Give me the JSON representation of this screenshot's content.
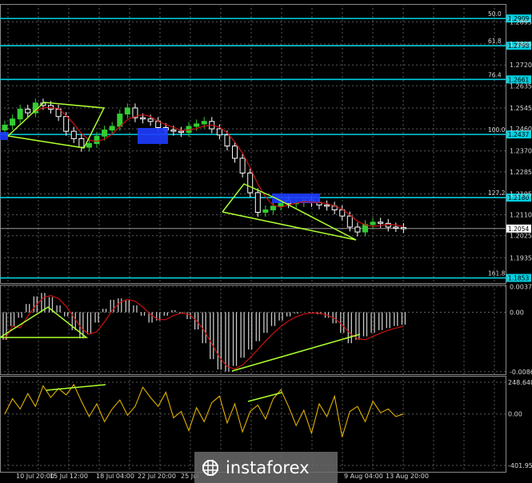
{
  "chart_data": [
    {
      "type": "candlestick",
      "panel": "price",
      "grid": true,
      "ylim": [
        1.1832,
        1.2968
      ],
      "y_ticks": [
        "1.2895",
        "1.2805",
        "1.2720",
        "1.2635",
        "1.2545",
        "1.2460",
        "1.2370",
        "1.2285",
        "1.2195",
        "1.2110",
        "1.2025",
        "1.1935"
      ],
      "current_price": "1.2054",
      "fib_levels": [
        {
          "ratio": "50.0",
          "price": "1.2909",
          "value": 1.2909
        },
        {
          "ratio": "61.8",
          "price": "1.2798",
          "value": 1.2798
        },
        {
          "ratio": "76.4",
          "price": "1.2661",
          "value": 1.2661
        },
        {
          "ratio": "100.0",
          "price": "1.2437",
          "value": 1.2437
        },
        {
          "ratio": "127.2",
          "price": "1.2180",
          "value": 1.218
        },
        {
          "ratio": "161.8",
          "price": "1.1853",
          "value": 1.1853
        }
      ],
      "close": [
        1.2475,
        1.25,
        1.254,
        1.2525,
        1.2565,
        1.2555,
        1.254,
        1.251,
        1.245,
        1.242,
        1.2385,
        1.24,
        1.243,
        1.2455,
        1.247,
        1.252,
        1.2545,
        1.2505,
        1.25,
        1.249,
        1.2465,
        1.2455,
        1.245,
        1.2445,
        1.247,
        1.248,
        1.249,
        1.246,
        1.2435,
        1.239,
        1.234,
        1.228,
        1.22,
        1.212,
        1.213,
        1.2145,
        1.217,
        1.2155,
        1.216,
        1.217,
        1.216,
        1.215,
        1.2145,
        1.213,
        1.2105,
        1.206,
        1.204,
        1.207,
        1.208,
        1.2075,
        1.206,
        1.2058,
        1.2054
      ],
      "x_ticks": [
        "10 Jul 20:00",
        "15 Jul 12:00",
        "18 Jul 04:00",
        "22 Jul 20:00",
        "25 Jul",
        "9 Aug 04:00",
        "13 Aug 20:00"
      ],
      "colors": {
        "bull": "#32cd32",
        "bear": "#ffffff",
        "fib": "#00d0e0",
        "pattern": "#adff2f",
        "signal": "#cc1111"
      }
    },
    {
      "type": "histogram",
      "panel": "oscillator",
      "grid": true,
      "y_ticks": [
        "0.00373",
        "0.00",
        "-0.00863"
      ],
      "ylim": [
        -0.009,
        0.004
      ],
      "values": [
        -0.004,
        -0.002,
        -0.0008,
        0.0012,
        0.0023,
        0.0028,
        0.0022,
        0.001,
        -0.0006,
        -0.0026,
        -0.0038,
        -0.0032,
        -0.0015,
        0.0005,
        0.0018,
        0.002,
        0.0018,
        0.001,
        -0.0005,
        -0.0015,
        -0.0012,
        -0.0005,
        0.0003,
        -0.0002,
        -0.001,
        -0.0025,
        -0.0045,
        -0.0068,
        -0.0083,
        -0.0086,
        -0.0078,
        -0.0066,
        -0.0054,
        -0.0042,
        -0.003,
        -0.002,
        -0.0012,
        -0.0006,
        -0.0002,
        0.0,
        -0.0001,
        -0.0003,
        -0.0008,
        -0.0016,
        -0.003,
        -0.0045,
        -0.004,
        -0.0035,
        -0.003,
        -0.0026,
        -0.0023,
        -0.002,
        -0.0018
      ]
    },
    {
      "type": "line",
      "panel": "cci",
      "grid": true,
      "y_ticks": [
        "248.6406",
        "0.00",
        "-401.958"
      ],
      "ylim": [
        -401.958,
        248.6406
      ],
      "values": [
        0,
        120,
        40,
        160,
        60,
        220,
        130,
        200,
        150,
        230,
        100,
        -20,
        80,
        -60,
        40,
        110,
        -10,
        60,
        210,
        130,
        60,
        170,
        -30,
        20,
        -130,
        50,
        -60,
        90,
        140,
        -70,
        80,
        -140,
        20,
        70,
        -40,
        120,
        190,
        60,
        -90,
        30,
        -150,
        80,
        -20,
        140,
        -180,
        20,
        60,
        -60,
        100,
        10,
        40,
        -20,
        0
      ]
    }
  ],
  "watermark": {
    "text": "instaforex",
    "icon": "instaforex-logo-icon"
  }
}
